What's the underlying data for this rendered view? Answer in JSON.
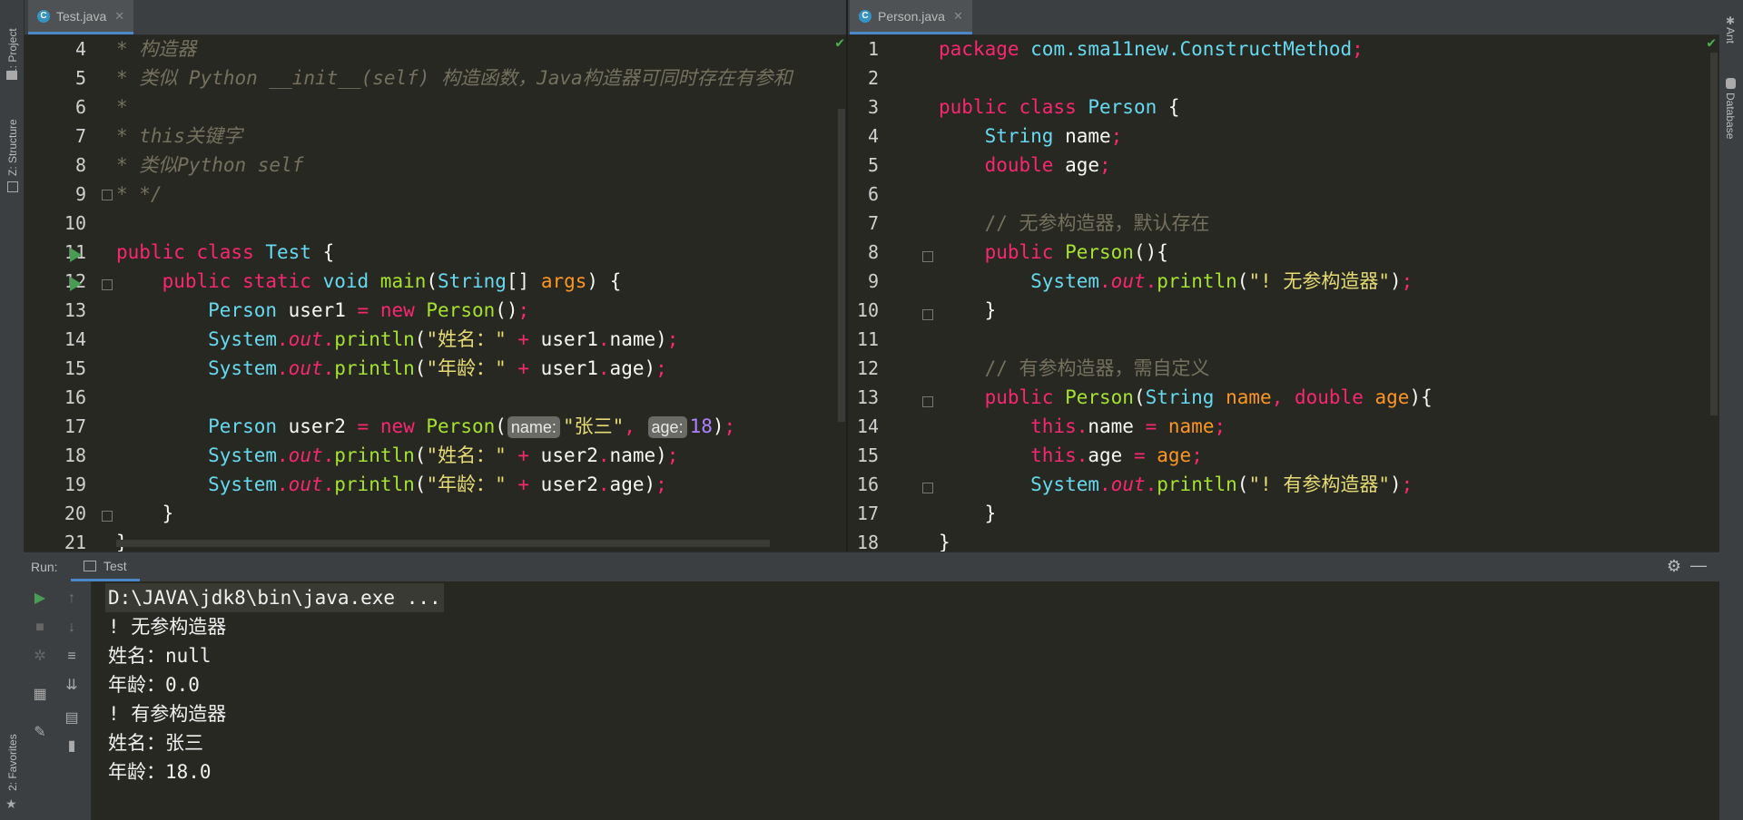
{
  "sidebar_left": {
    "project": "1: Project",
    "structure": "Z: Structure",
    "favorites": "2: Favorites"
  },
  "sidebar_right": {
    "ant": "Ant",
    "database": "Database"
  },
  "left_editor": {
    "tab": "Test.java",
    "tab_icon": "C",
    "line_numbers": [
      "4",
      "5",
      "6",
      "7",
      "8",
      "9",
      "10",
      "11",
      "12",
      "13",
      "14",
      "15",
      "16",
      "17",
      "18",
      "19",
      "20",
      "21"
    ],
    "c1": "* 构造器",
    "c2": "* 类似 Python __init__(self) 构造函数，Java构造器可同时存在有参和",
    "c3": "*",
    "c4": "* this关键字",
    "c5": "* 类似Python self",
    "c6": "* */",
    "hint_name": "name:",
    "hint_age": "age:",
    "str_name_label": "\"姓名：\"",
    "str_age_label": "\"年龄：\"",
    "str_zhangsan": "\"张三\"",
    "num_18": "18"
  },
  "right_editor": {
    "tab": "Person.java",
    "tab_icon": "C",
    "line_numbers": [
      "1",
      "2",
      "3",
      "4",
      "5",
      "6",
      "7",
      "8",
      "9",
      "10",
      "11",
      "12",
      "13",
      "14",
      "15",
      "16",
      "17",
      "18"
    ],
    "package_name": "com.sma11new.ConstructMethod",
    "comment_noarg": "// 无参构造器，默认存在",
    "comment_arg": "// 有参构造器，需自定义",
    "str_noarg": "\"! 无参构造器\"",
    "str_arg": "\"! 有参构造器\""
  },
  "run_panel": {
    "label": "Run:",
    "tab": "Test",
    "console": [
      "D:\\JAVA\\jdk8\\bin\\java.exe ...",
      "! 无参构造器",
      "姓名：null",
      "年龄：0.0",
      "! 有参构造器",
      "姓名：张三",
      "年龄：18.0"
    ]
  }
}
